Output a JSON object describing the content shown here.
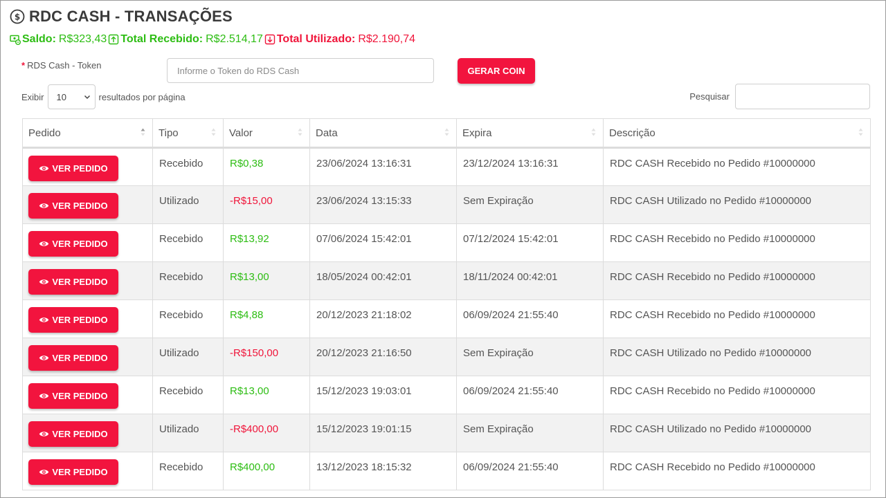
{
  "page": {
    "title": "RDC CASH - TRANSAÇÕES"
  },
  "summary": {
    "saldo_label": "Saldo:",
    "saldo_value": "R$323,43",
    "recebido_label": "Total Recebido:",
    "recebido_value": "R$2.514,17",
    "utilizado_label": "Total Utilizado:",
    "utilizado_value": "R$2.190,74"
  },
  "token": {
    "required_mark": "*",
    "label": "RDS Cash - Token",
    "placeholder": "Informe o Token do RDS Cash",
    "button": "GERAR COIN"
  },
  "length": {
    "prefix": "Exibir",
    "value": "10",
    "suffix": "resultados por página"
  },
  "search": {
    "label": "Pesquisar"
  },
  "table": {
    "columns": [
      "Pedido",
      "Tipo",
      "Valor",
      "Data",
      "Expira",
      "Descrição"
    ],
    "button_label": "VER PEDIDO",
    "rows": [
      {
        "tipo": "Recebido",
        "valor": "R$0,38",
        "data": "23/06/2024 13:16:31",
        "expira": "23/12/2024 13:16:31",
        "descricao": "RDC CASH Recebido no Pedido #10000000"
      },
      {
        "tipo": "Utilizado",
        "valor": "-R$15,00",
        "data": "23/06/2024 13:15:33",
        "expira": "Sem Expiração",
        "descricao": "RDC CASH Utilizado no Pedido #10000000"
      },
      {
        "tipo": "Recebido",
        "valor": "R$13,92",
        "data": "07/06/2024 15:42:01",
        "expira": "07/12/2024 15:42:01",
        "descricao": "RDC CASH Recebido no Pedido #10000000"
      },
      {
        "tipo": "Recebido",
        "valor": "R$13,00",
        "data": "18/05/2024 00:42:01",
        "expira": "18/11/2024 00:42:01",
        "descricao": "RDC CASH Recebido no Pedido #10000000"
      },
      {
        "tipo": "Recebido",
        "valor": "R$4,88",
        "data": "20/12/2023 21:18:02",
        "expira": "06/09/2024 21:55:40",
        "descricao": "RDC CASH Recebido no Pedido #10000000"
      },
      {
        "tipo": "Utilizado",
        "valor": "-R$150,00",
        "data": "20/12/2023 21:16:50",
        "expira": "Sem Expiração",
        "descricao": "RDC CASH Utilizado no Pedido #10000000"
      },
      {
        "tipo": "Recebido",
        "valor": "R$13,00",
        "data": "15/12/2023 19:03:01",
        "expira": "06/09/2024 21:55:40",
        "descricao": "RDC CASH Recebido no Pedido #10000000"
      },
      {
        "tipo": "Utilizado",
        "valor": "-R$400,00",
        "data": "15/12/2023 19:01:15",
        "expira": "Sem Expiração",
        "descricao": "RDC CASH Utilizado no Pedido #10000000"
      },
      {
        "tipo": "Recebido",
        "valor": "R$400,00",
        "data": "13/12/2023 18:15:32",
        "expira": "06/09/2024 21:55:40",
        "descricao": "RDC CASH Recebido no Pedido #10000000"
      }
    ]
  },
  "colors": {
    "accent": "#f2143e",
    "positive": "#2dbd13",
    "negative": "#f0153a"
  },
  "icons": {
    "title": "dollar-coin-icon",
    "saldo": "money-refresh-icon",
    "recebido": "arrow-up-box-icon",
    "utilizado": "arrow-down-box-icon",
    "button": "eye-icon",
    "sort": "sort-icon",
    "select": "chevron-down-icon"
  }
}
